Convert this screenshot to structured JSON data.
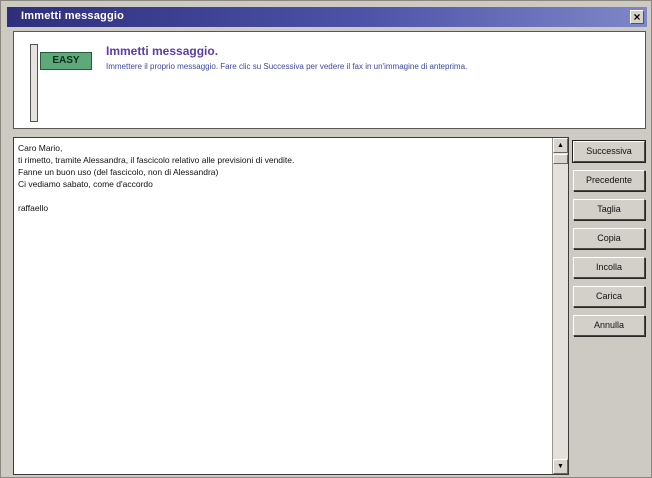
{
  "window": {
    "title": "Immetti messaggio"
  },
  "header": {
    "logo_text": "EASY",
    "title": "Immetti messaggio.",
    "description": "Immettere il proprio messaggio. Fare clic su Successiva per vedere il fax in un'immagine di anteprima."
  },
  "message": {
    "lines": [
      "Caro Mario,",
      "ti rimetto, tramite Alessandra, il fascicolo relativo alle previsioni di vendite.",
      "Fanne un buon uso (del fascicolo, non di Alessandra)",
      "Ci vediamo sabato, come d'accordo",
      "",
      "raffaello"
    ]
  },
  "buttons": {
    "next": "Successiva",
    "previous": "Precedente",
    "cut": "Taglia",
    "copy": "Copia",
    "paste": "Incolla",
    "load": "Carica",
    "cancel": "Annulla"
  },
  "icons": {
    "close": "close-icon",
    "scroll_up": "arrow-up-icon",
    "scroll_down": "arrow-down-icon",
    "logo": "signpost-logo"
  }
}
